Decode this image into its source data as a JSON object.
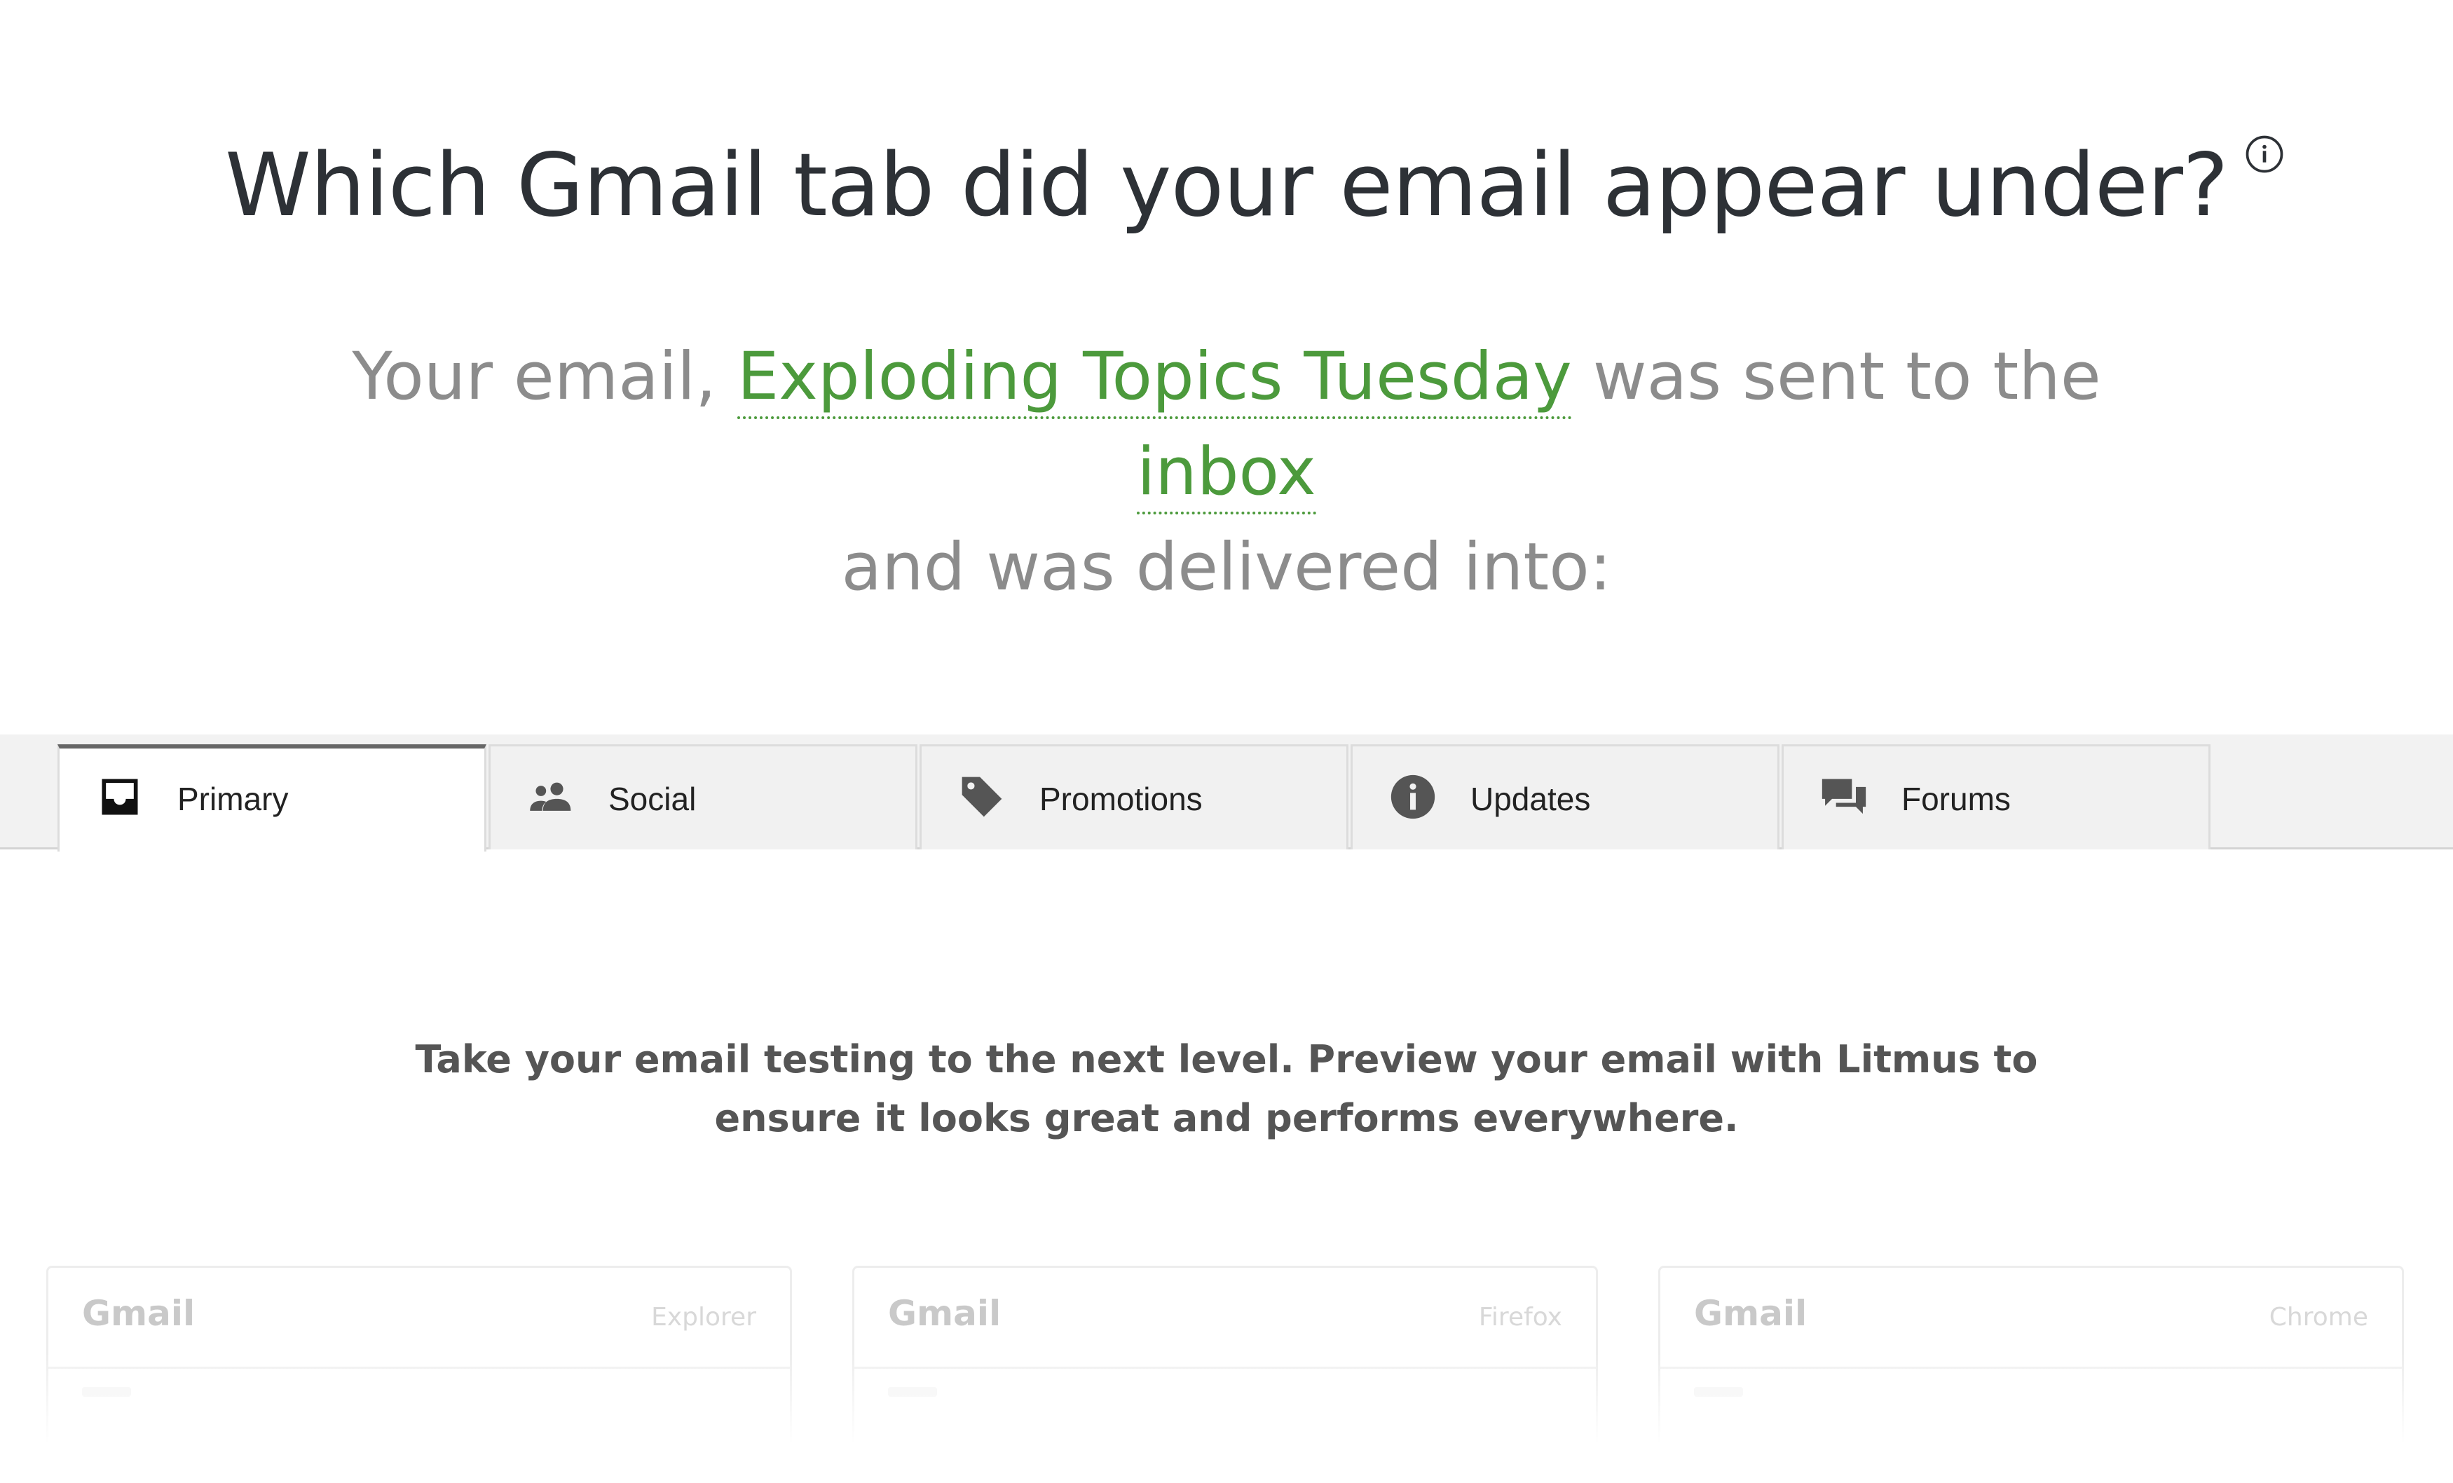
{
  "heading": {
    "text": "Which Gmail tab did your email appear under?",
    "info_icon": "info-circle-icon"
  },
  "status": {
    "prefix": "Your email,",
    "email_name": "Exploding Topics Tuesday",
    "middle": "was sent to the",
    "folder": "inbox",
    "suffix": "and was delivered into:"
  },
  "tabs": [
    {
      "label": "Primary",
      "icon": "inbox-icon",
      "active": true
    },
    {
      "label": "Social",
      "icon": "people-icon",
      "active": false
    },
    {
      "label": "Promotions",
      "icon": "tag-icon",
      "active": false
    },
    {
      "label": "Updates",
      "icon": "info-icon",
      "active": false
    },
    {
      "label": "Forums",
      "icon": "chat-bubbles-icon",
      "active": false
    }
  ],
  "promo": {
    "text": "Take your email testing to the next level. Preview your email with Litmus to ensure it looks great and performs everywhere."
  },
  "previews": [
    {
      "client": "Gmail",
      "browser": "Explorer"
    },
    {
      "client": "Gmail",
      "browser": "Firefox"
    },
    {
      "client": "Gmail",
      "browser": "Chrome"
    }
  ],
  "colors": {
    "heading": "#2d3136",
    "muted_text": "#8c8c8c",
    "highlight_green": "#4c9a3c",
    "tab_bar_bg": "#f2f2f2",
    "active_tab_border": "#666666"
  }
}
